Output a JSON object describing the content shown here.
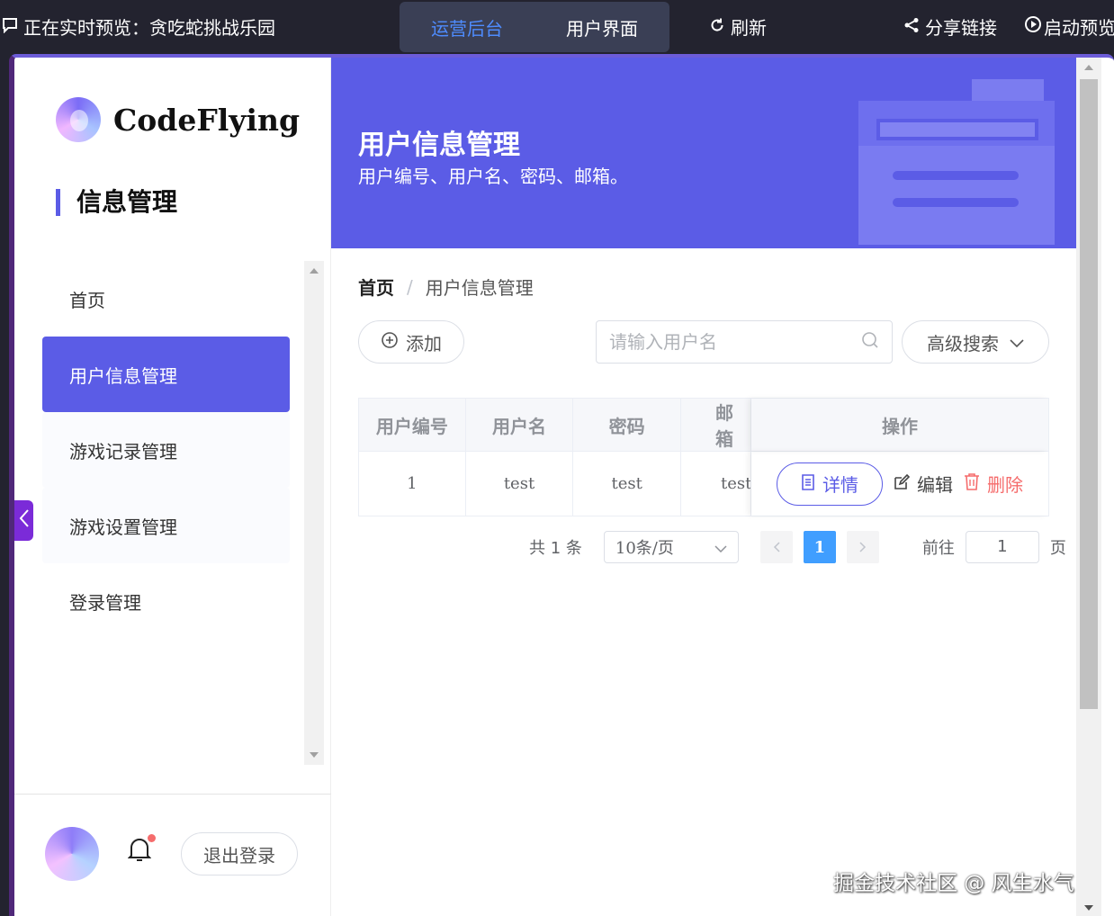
{
  "topbar": {
    "preview_prefix": "正在实时预览：",
    "project_name": "贪吃蛇挑战乐园",
    "tabs": [
      {
        "label": "运营后台",
        "active": true
      },
      {
        "label": "用户界面",
        "active": false
      }
    ],
    "refresh_label": "刷新",
    "share_label": "分享链接",
    "launch_label": "启动预览"
  },
  "sidebar": {
    "brand": "CodeFlying",
    "section_title": "信息管理",
    "items": [
      {
        "label": "首页"
      },
      {
        "label": "用户信息管理"
      },
      {
        "label": "游戏记录管理"
      },
      {
        "label": "游戏设置管理"
      },
      {
        "label": "登录管理"
      }
    ],
    "logout_label": "退出登录"
  },
  "banner": {
    "title": "用户信息管理",
    "subtitle": "用户编号、用户名、密码、邮箱。"
  },
  "breadcrumb": {
    "home": "首页",
    "separator": "/",
    "current": "用户信息管理"
  },
  "toolbar": {
    "add_label": "添加",
    "search_placeholder": "请输入用户名",
    "advanced_label": "高级搜索"
  },
  "table": {
    "columns": [
      "用户编号",
      "用户名",
      "密码",
      "邮箱",
      "操作"
    ],
    "rows": [
      {
        "id": "1",
        "username": "test",
        "password": "test",
        "email": "test"
      }
    ],
    "actions": {
      "detail": "详情",
      "edit": "编辑",
      "delete": "删除"
    }
  },
  "pagination": {
    "total": "共 1 条",
    "page_size": "10条/页",
    "current_page": "1",
    "goto_label": "前往",
    "goto_value": "1",
    "page_suffix": "页"
  },
  "watermark": "掘金技术社区 @ 风生水气",
  "colors": {
    "primary": "#5b5ce6",
    "topbar_bg": "#23232f",
    "accent_blue": "#4e8cff",
    "danger": "#f56c6c",
    "pager_active": "#409eff"
  }
}
